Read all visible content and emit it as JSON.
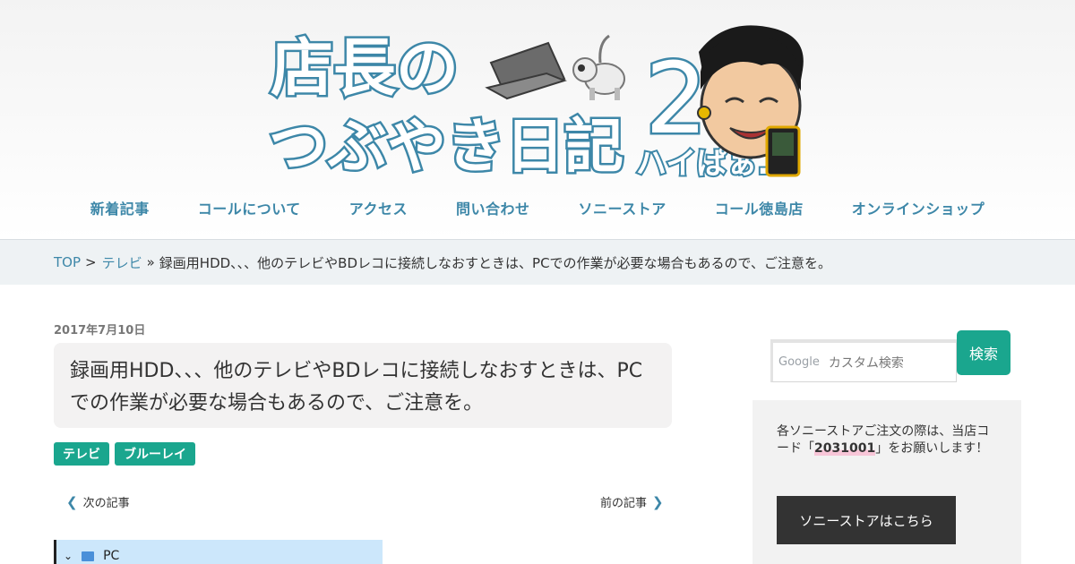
{
  "header": {
    "logo_alt": "店長のつぶやき日記2 ハイぱぁ...",
    "logo_lines": [
      "店長の",
      "つぶやき日記",
      "2",
      "ハイぱぁ..."
    ]
  },
  "nav": [
    {
      "label": "新着記事"
    },
    {
      "label": "コールについて"
    },
    {
      "label": "アクセス"
    },
    {
      "label": "問い合わせ"
    },
    {
      "label": "ソニーストア"
    },
    {
      "label": "コール徳島店"
    },
    {
      "label": "オンラインショップ"
    }
  ],
  "breadcrumb": {
    "top": "TOP",
    "sep1": ">",
    "category": "テレビ",
    "sep2": "»",
    "current": "録画用HDD、、、他のテレビやBDレコに接続しなおすときは、PCでの作業が必要な場合もあるので、ご注意を。"
  },
  "article": {
    "date": "2017年7月10日",
    "title": "録画用HDD、、、他のテレビやBDレコに接続しなおすときは、PCでの作業が必要な場合もあるので、ご注意を。",
    "tags": [
      "テレビ",
      "ブルーレイ"
    ],
    "prev_label": "次の記事",
    "next_label": "前の記事",
    "screenshot_tree_label": "PC"
  },
  "sidebar": {
    "search_brand": "Google",
    "search_placeholder": "カスタム検索",
    "search_button": "検索",
    "notice_before": "各ソニーストアご注文の際は、当店コード「",
    "notice_code": "2031001",
    "notice_after": "」をお願いします！",
    "store_button": "ソニーストアはこちら"
  },
  "colors": {
    "accent": "#1aa68e",
    "link": "#3d87a8",
    "breadcrumb_bg": "#eef2f4",
    "dark_button": "#333333"
  }
}
